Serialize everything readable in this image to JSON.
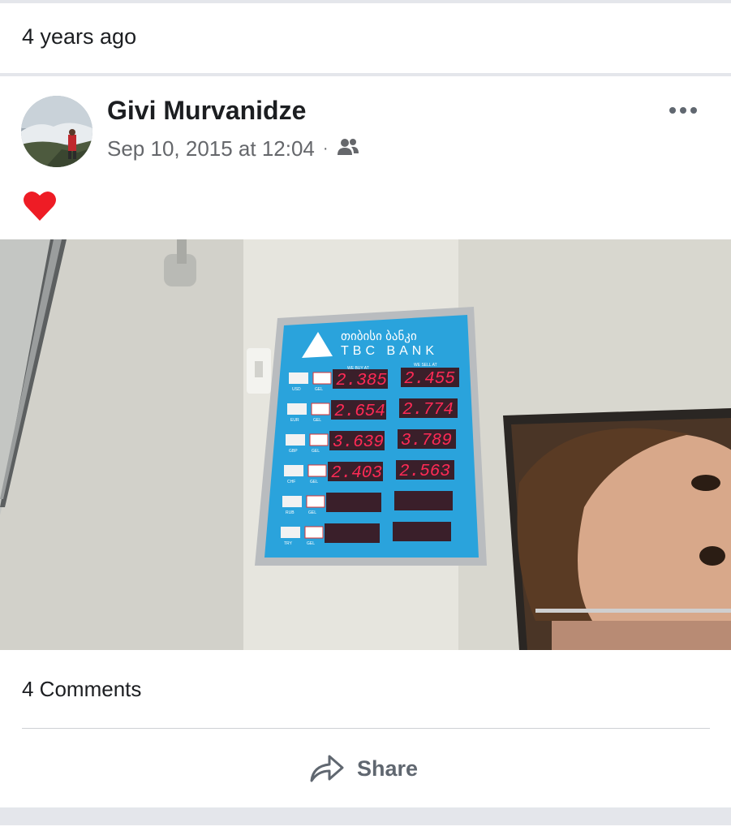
{
  "memory": {
    "time_ago": "4 years ago"
  },
  "post": {
    "author": "Givi Murvanidze",
    "timestamp": "Sep 10, 2015 at 12:04",
    "separator": "·",
    "audience_icon": "friends-icon",
    "text_icon": "red-heart-emoji",
    "more_icon": "more-options-icon",
    "comments_label": "4 Comments",
    "share_label": "Share",
    "share_icon": "share-arrow-icon"
  },
  "photo": {
    "board_title_georgian": "თიბისი ბანკი",
    "board_title_latin": "TBC BANK",
    "col_buy": "WE BUY AT",
    "col_sell": "WE SELL AT",
    "rates": [
      {
        "cur": "USD",
        "base": "GEL",
        "buy": "2.385",
        "sell": "2.455"
      },
      {
        "cur": "EUR",
        "base": "GEL",
        "buy": "2.654",
        "sell": "2.774"
      },
      {
        "cur": "GBP",
        "base": "GEL",
        "buy": "3.639",
        "sell": "3.789"
      },
      {
        "cur": "CHF",
        "base": "GEL",
        "buy": "2.403",
        "sell": "2.563"
      },
      {
        "cur": "RUB",
        "base": "GEL",
        "buy": "",
        "sell": ""
      },
      {
        "cur": "TRY",
        "base": "GEL",
        "buy": "",
        "sell": ""
      }
    ]
  },
  "colors": {
    "text_primary": "#1c1e21",
    "text_secondary": "#65676b",
    "separator": "#e4e6eb",
    "board_blue": "#2aa3dc",
    "led_red": "#ff2a55"
  }
}
